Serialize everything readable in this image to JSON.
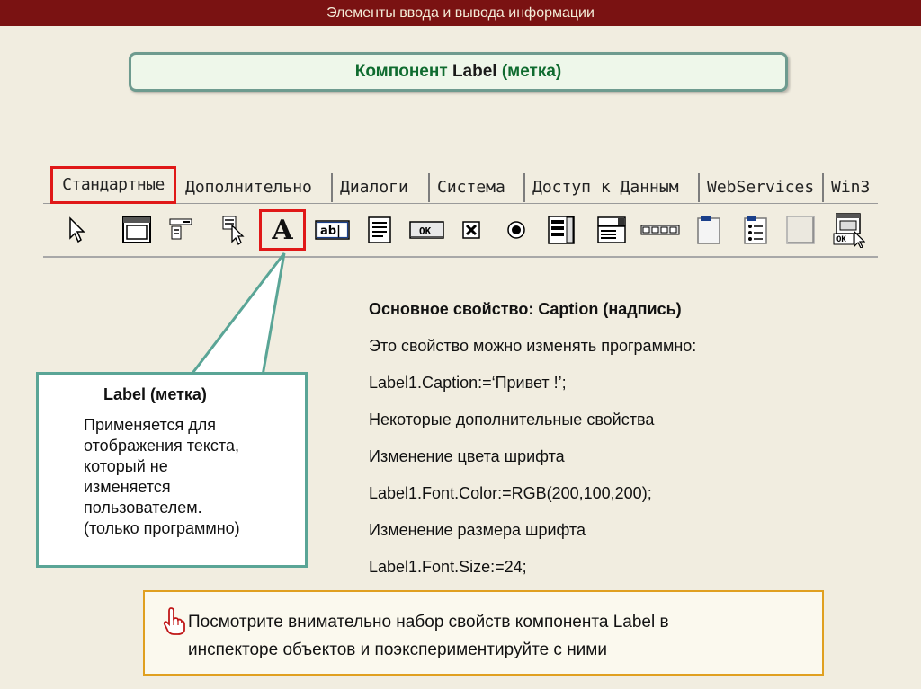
{
  "header": {
    "title": "Элементы ввода и вывода информации"
  },
  "slide_title": {
    "prefix": "Компонент ",
    "name": "Label",
    "suffix": " (метка)"
  },
  "palette": {
    "tabs": [
      {
        "label": "Стандартные",
        "active": true
      },
      {
        "label": "Дополнительно"
      },
      {
        "label": "Диалоги"
      },
      {
        "label": "Система"
      },
      {
        "label": "Доступ к Данным"
      },
      {
        "label": "WebServices"
      },
      {
        "label": "Win3"
      }
    ],
    "tools": [
      {
        "icon": "pointer-arrow-icon"
      },
      {
        "icon": "frame-icon"
      },
      {
        "icon": "main-menu-icon"
      },
      {
        "icon": "popup-menu-icon"
      },
      {
        "icon": "label-a-icon",
        "text": "A"
      },
      {
        "icon": "edit-icon",
        "text": "ab|"
      },
      {
        "icon": "memo-icon"
      },
      {
        "icon": "button-ok-icon",
        "text": "OK"
      },
      {
        "icon": "checkbox-icon"
      },
      {
        "icon": "radiobutton-icon"
      },
      {
        "icon": "listbox-icon"
      },
      {
        "icon": "combobox-icon"
      },
      {
        "icon": "scrollbar-icon"
      },
      {
        "icon": "groupbox-icon"
      },
      {
        "icon": "radiogroup-icon"
      },
      {
        "icon": "panel-icon"
      },
      {
        "icon": "actionlist-icon",
        "text": "OK"
      }
    ]
  },
  "callout": {
    "heading": "Label (метка)",
    "lines": [
      "Применяется для",
      "отображения текста,",
      "который не",
      "изменяется",
      "пользователем.",
      "(только программно)"
    ]
  },
  "properties": {
    "main": "Основное свойство: Caption (надпись)",
    "lines": [
      "Это свойство можно изменять программно:",
      "Label1.Caption:=‘Привет !’;",
      "Некоторые дополнительные свойства",
      "Изменение цвета шрифта",
      "Label1.Font.Color:=RGB(200,100,200);",
      "Изменение размера шрифта",
      "Label1.Font.Size:=24;"
    ]
  },
  "notice": {
    "icon": "pointing-hand-icon",
    "line1": "Посмотрите внимательно набор свойств компонента Label в",
    "line2": "инспекторе объектов и поэкспериментируйте с ними"
  }
}
